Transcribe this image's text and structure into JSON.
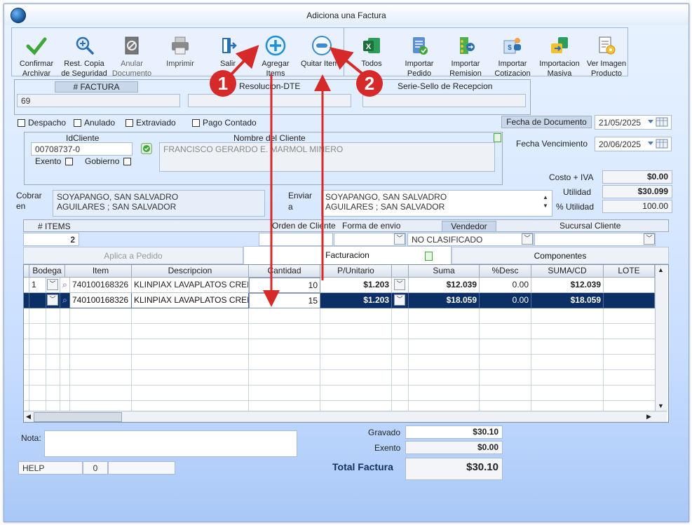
{
  "window": {
    "title": "Adiciona una Factura"
  },
  "toolbar": {
    "confirm": "Confirmar Archivar",
    "restore": "Rest. Copia de Seguridad",
    "cancel_doc": "Anular Documento",
    "print": "Imprimir",
    "exit": "Salir",
    "add_items": "Agregar Items",
    "remove_items": "Quitar Items",
    "all": "Todos",
    "import_order": "Importar Pedido",
    "import_remission": "Importar Remision",
    "import_quote": "Importar Cotizacion",
    "import_bulk": "Importacion Masiva",
    "view_image": "Ver Imagen Producto"
  },
  "invoice": {
    "number_label": "# FACTURA",
    "number": "69",
    "resolution_label": "Resolucion-DTE",
    "resolution": "",
    "serie_label": "Serie-Sello de Recepcion",
    "serie": ""
  },
  "flags": {
    "despacho": "Despacho",
    "anulado": "Anulado",
    "extraviado": "Extraviado",
    "pago_contado": "Pago Contado"
  },
  "dates": {
    "doc_label": "Fecha de  Documento",
    "doc": "21/05/2025",
    "due_label": "Fecha Vencimiento",
    "due": "20/06/2025"
  },
  "client": {
    "id_label": "IdCliente",
    "id": "00708737-0",
    "name_label": "Nombre del Cliente",
    "name": "FRANCISCO GERARDO E. MARMOL MINERO",
    "exento": "Exento",
    "gobierno": "Gobierno"
  },
  "costs": {
    "costo_label": "Costo + IVA",
    "costo": "$0.00",
    "utilidad_label": "Utilidad",
    "utilidad": "$30.099",
    "pct_label": "% Utilidad",
    "pct": "100.00"
  },
  "address": {
    "cobrar_label_1": "Cobrar",
    "cobrar_label_2": "en",
    "cobrar_1": "SOYAPANGO, SAN SALVADRO",
    "cobrar_2": "AGUILARES ; SAN SALVADOR",
    "enviar_label_1": "Enviar",
    "enviar_label_2": "a",
    "enviar_1": "SOYAPANGO, SAN SALVADRO",
    "enviar_2": "AGUILARES ; SAN SALVADOR"
  },
  "meta": {
    "items_label": "# ITEMS",
    "items": "2",
    "orden_label": "Orden de Cliente",
    "forma_label": "Forma de envio",
    "vendedor_label": "Vendedor",
    "vendedor": "NO CLASIFICADO",
    "sucursal_label": "Sucursal Cliente"
  },
  "tabs": [
    "Aplica a Pedido",
    "Facturacion",
    "Componentes"
  ],
  "grid": {
    "headers": [
      "Bodega",
      "Item",
      "Descripcion",
      "Cantidad",
      "P/Unitario",
      "Suma",
      "%Desc",
      "SUMA/CD",
      "LOTE"
    ],
    "rows": [
      {
        "bodega": "1",
        "item": "740100168326",
        "desc": "KLINPIAX LAVAPLATOS CREI",
        "qty": "10",
        "price": "$1.203",
        "suma": "$12.039",
        "desc_pct": "0.00",
        "sumacd": "$12.039",
        "lote": ""
      },
      {
        "bodega": "",
        "item": "740100168326",
        "desc": "KLINPIAX LAVAPLATOS CREI",
        "qty": "15",
        "price": "$1.203",
        "suma": "$18.059",
        "desc_pct": "0.00",
        "sumacd": "$18.059",
        "lote": ""
      }
    ]
  },
  "footer": {
    "nota_label": "Nota:",
    "help": "HELP",
    "help_count": "0",
    "gravado_label": "Gravado",
    "gravado": "$30.10",
    "exento_label": "Exento",
    "exento": "$0.00",
    "total_label": "Total Factura",
    "total": "$30.10"
  },
  "callouts": [
    "1",
    "2"
  ],
  "colors": {
    "accent": "#0c2f66",
    "callout": "#d62a2a"
  }
}
